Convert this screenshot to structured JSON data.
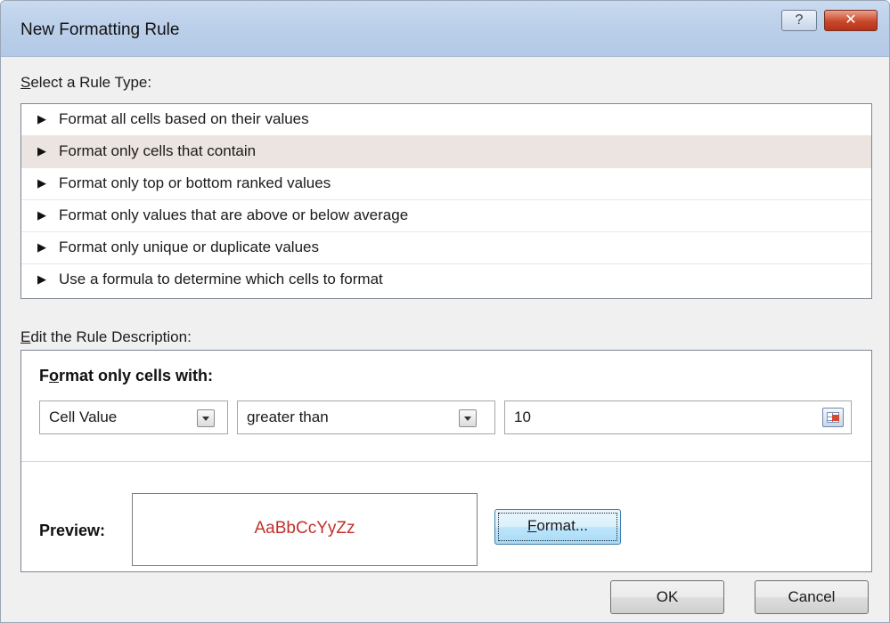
{
  "window": {
    "title": "New Formatting Rule",
    "help_label": "?",
    "close_label": "✕"
  },
  "rule_type": {
    "heading_accel": "S",
    "heading_rest": "elect a Rule Type:",
    "items": [
      {
        "label": "Format all cells based on their values",
        "selected": false
      },
      {
        "label": "Format only cells that contain",
        "selected": true
      },
      {
        "label": "Format only top or bottom ranked values",
        "selected": false
      },
      {
        "label": "Format only values that are above or below average",
        "selected": false
      },
      {
        "label": "Format only unique or duplicate values",
        "selected": false
      },
      {
        "label": "Use a formula to determine which cells to format",
        "selected": false
      }
    ],
    "arrow_glyph": "▶"
  },
  "description": {
    "heading_accel": "E",
    "heading_rest": "dit the Rule Description:",
    "section_prefix": "F",
    "section_accel": "o",
    "section_rest": "rmat only cells with:",
    "condition_type": "Cell Value",
    "operator": "greater than",
    "value": "10",
    "ref_icon": "collapse-dialog-icon"
  },
  "preview": {
    "label": "Preview:",
    "sample_text": "AaBbCcYyZz",
    "sample_color": "#c0302b",
    "format_button_accel": "F",
    "format_button_rest": "ormat..."
  },
  "buttons": {
    "ok": "OK",
    "cancel": "Cancel"
  }
}
